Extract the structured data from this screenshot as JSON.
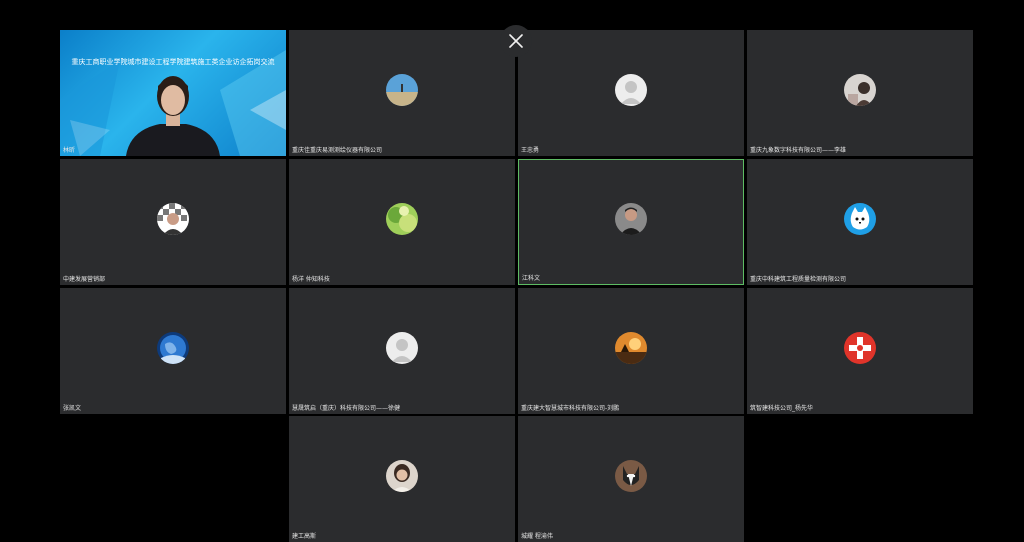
{
  "meeting": {
    "banner": "重庆工商职业学院城市建设工程学院建筑施工类企业访企拓岗交流",
    "participants": [
      {
        "name": "林昕",
        "avatar": "speaker-video"
      },
      {
        "name": "重庆佳重庆易测测绘仪器有限公司",
        "avatar": "landscape-photo-icon"
      },
      {
        "name": "王忠勇",
        "avatar": "default-user-icon"
      },
      {
        "name": "重庆九象数字科技有限公司——李雄",
        "avatar": "person-photo-icon"
      },
      {
        "name": "中建发展营销部",
        "avatar": "checker-person-icon"
      },
      {
        "name": "杨洋 仲知科技",
        "avatar": "plant-photo-icon"
      },
      {
        "name": "江科文",
        "avatar": "man-photo-icon"
      },
      {
        "name": "重庆中科建筑工程质量检测有限公司",
        "avatar": "white-cat-icon"
      },
      {
        "name": "张凯文",
        "avatar": "earth-icon"
      },
      {
        "name": "慧晟筑启（重庆）科技有限公司——徐健",
        "avatar": "default-user-icon"
      },
      {
        "name": "重庆建大智慧城市科技有限公司-刘鹏",
        "avatar": "sunset-photo-icon"
      },
      {
        "name": "筑智建科技公司_杨先华",
        "avatar": "red-cross-logo-icon"
      },
      {
        "name": "建工高斯",
        "avatar": "woman-photo-icon"
      },
      {
        "name": "城耀 程渝伟",
        "avatar": "dog-photo-icon"
      }
    ]
  }
}
